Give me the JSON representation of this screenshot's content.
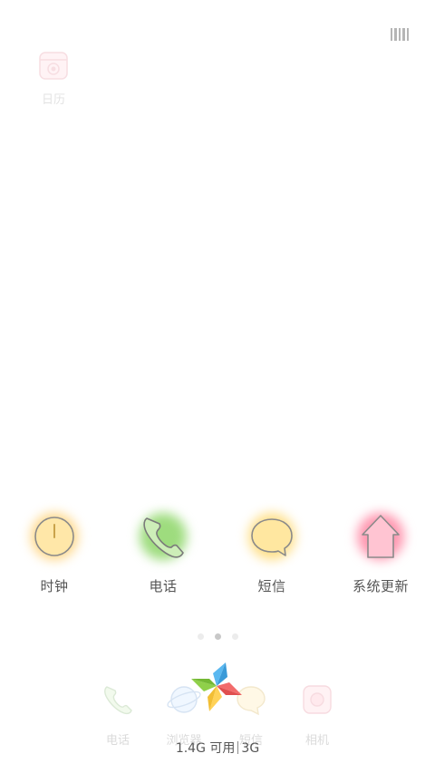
{
  "top_bar": {
    "icon": "barcode-icon"
  },
  "calendar_shortcut": {
    "label": "日历",
    "icon": "calendar-icon"
  },
  "apps": [
    {
      "label": "时钟",
      "icon": "clock-icon",
      "glow": "#ffd88a"
    },
    {
      "label": "电话",
      "icon": "phone-icon",
      "glow": "#a8e08a"
    },
    {
      "label": "短信",
      "icon": "message-icon",
      "glow": "#ffe08a"
    },
    {
      "label": "系统更新",
      "icon": "home-update-icon",
      "glow": "#ff9fb6"
    }
  ],
  "page_indicator": {
    "count": 3,
    "active_index": 1
  },
  "dock": [
    {
      "label": "电话",
      "icon": "phone-icon"
    },
    {
      "label": "浏览器",
      "icon": "browser-icon"
    },
    {
      "label": "短信",
      "icon": "message-icon"
    },
    {
      "label": "相机",
      "icon": "camera-icon"
    }
  ],
  "cleaner": {
    "icon": "pinwheel-icon",
    "memory_text": "1.4G 可用",
    "network_text": "3G"
  },
  "colors": {
    "pinwheel_blue": "#5ab8f0",
    "pinwheel_red": "#f26b6b",
    "pinwheel_yellow": "#ffd257",
    "pinwheel_green": "#8fd04a"
  }
}
